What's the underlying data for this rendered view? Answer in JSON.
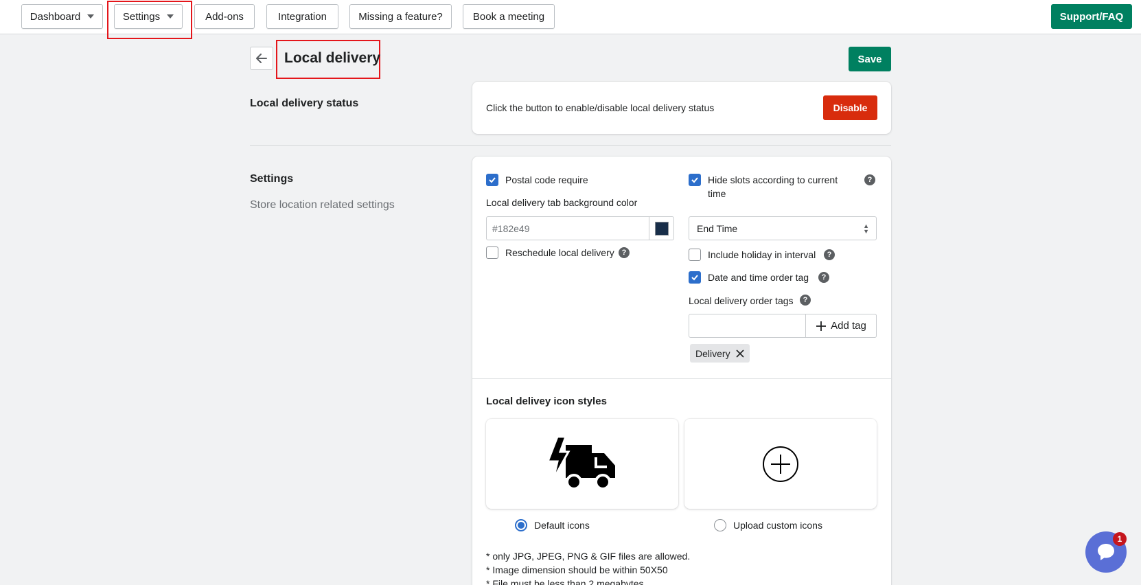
{
  "nav": {
    "dashboard": "Dashboard",
    "settings": "Settings",
    "addons": "Add-ons",
    "integration": "Integration",
    "missing_feature": "Missing a feature?",
    "book_meeting": "Book a meeting",
    "support": "Support/FAQ"
  },
  "header": {
    "title": "Local delivery",
    "save": "Save"
  },
  "status_section": {
    "title": "Local delivery status",
    "description": "Click the button to enable/disable local delivery status",
    "button": "Disable"
  },
  "settings_section": {
    "title": "Settings",
    "subtitle": "Store location related settings",
    "postal_code": {
      "label": "Postal code require",
      "checked": true
    },
    "bg_color": {
      "label": "Local delivery tab background color",
      "value": "#182e49",
      "swatch": "#182e49"
    },
    "reschedule": {
      "label": "Reschedule local delivery",
      "checked": false
    },
    "hide_slots": {
      "label": "Hide slots according to current time",
      "checked": true
    },
    "slot_select": {
      "value": "End Time"
    },
    "include_holiday": {
      "label": "Include holiday in interval",
      "checked": false
    },
    "date_time_tag": {
      "label": "Date and time order tag",
      "checked": true
    },
    "order_tags": {
      "label": "Local delivery order tags",
      "add_button": "Add tag",
      "tags": [
        "Delivery"
      ]
    },
    "icon_styles": {
      "title": "Local delivey icon styles",
      "default_label": "Default icons",
      "upload_label": "Upload custom icons",
      "selected": "default"
    },
    "notes": [
      "* only JPG, JPEG, PNG & GIF files are allowed.",
      "* Image dimension should be within 50X50",
      "* File must be less than 2 megabytes"
    ]
  },
  "chat": {
    "badge": "1"
  },
  "colors": {
    "primary": "#008060",
    "critical": "#d82c0d",
    "checkbox": "#2c6ecb",
    "highlight": "#e4161b"
  }
}
